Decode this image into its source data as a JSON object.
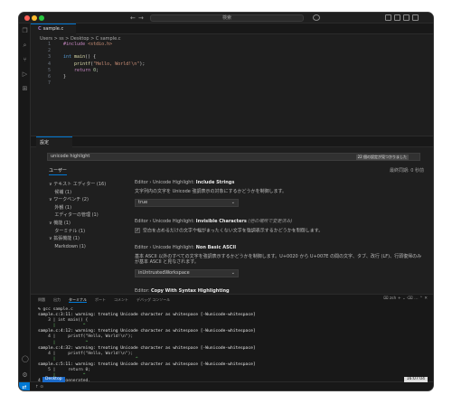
{
  "titlebar": {
    "search_placeholder": "検索",
    "back": "←",
    "forward": "→"
  },
  "activity_bar": {
    "items": [
      "explorer-icon",
      "search-icon",
      "source-control-icon",
      "run-debug-icon",
      "extensions-icon"
    ],
    "account": "account-icon",
    "manage": "gear-icon"
  },
  "editor": {
    "tab": {
      "prefix": "C",
      "label": "sample.c"
    },
    "breadcrumb": "Users > ss > Desktop > C sample.c",
    "line_numbers": [
      "1",
      "2",
      "3",
      "4",
      "5",
      "6",
      "7"
    ],
    "lines": [
      [
        {
          "t": "#include ",
          "c": "pp"
        },
        {
          "t": "<stdio.h>",
          "c": "inc"
        }
      ],
      [],
      [
        {
          "t": "int ",
          "c": "kw"
        },
        {
          "t": "main",
          "c": "fn"
        },
        {
          "t": "() {",
          "c": ""
        }
      ],
      [
        {
          "t": "    ",
          "c": ""
        },
        {
          "t": "printf",
          "c": "fn"
        },
        {
          "t": "(",
          "c": ""
        },
        {
          "t": "\"Hello, World!\\n\"",
          "c": "str"
        },
        {
          "t": ");",
          "c": ""
        }
      ],
      [
        {
          "t": "    ",
          "c": ""
        },
        {
          "t": "return ",
          "c": "pp"
        },
        {
          "t": "0",
          "c": "num"
        },
        {
          "t": ";",
          "c": ""
        }
      ],
      [
        {
          "t": "}",
          "c": ""
        }
      ],
      []
    ]
  },
  "settings": {
    "tab_label": "設定",
    "search_value": "unicode highlight",
    "found_badge": "22 個の設定が見つかりました",
    "user_tab": "ユーザー",
    "last_modified": "最終同期: 0 秒前",
    "tree": [
      "∨ テキスト エディター (16)",
      "    候補 (1)",
      "∨ ワークベンチ (2)",
      "    外観 (1)",
      "    エディターの管理 (1)",
      "∨ 機能 (1)",
      "    ターミナル (1)",
      "∨ 拡張機能 (1)",
      "    Markdown (1)"
    ],
    "items": {
      "include_strings": {
        "crumb": "Editor › Unicode Highlight: ",
        "name": "Include Strings",
        "desc": "文字列内の文字を Unicode 強調表示の対象にするかどうかを制御します。",
        "value": "true"
      },
      "invisible": {
        "crumb": "Editor › Unicode Highlight: ",
        "name": "Invisible Characters",
        "note": " (他の場所で変更済み)",
        "desc": "空白を占めるだけの文字や幅がまったくない文字を強調表示するかどうかを制御します。",
        "checked": "✓"
      },
      "non_basic": {
        "crumb": "Editor › Unicode Highlight: ",
        "name": "Non Basic ASCII",
        "desc": "基本 ASCII 以外のすべての文字を強調表示するかどうかを制御します。U+0020 から U+007E の間の文字、タブ、改行 (LF)、行頭復帰のみが基本 ASCII と見なされます。",
        "value": "inUntrustedWorkspace"
      },
      "copy_syntax": {
        "crumb": "Editor: ",
        "name": "Copy With Syntax Highlighting"
      }
    }
  },
  "panel": {
    "tabs": [
      "問題",
      "出力",
      "ターミナル",
      "ポート",
      "コメント",
      "デバッグ コンソール"
    ],
    "shell_label": "zsh",
    "terminal": [
      "% gcc sample.c",
      "sample.c:3:11: warning: treating Unicode character as whitespace [-Wunicode-whitespace]",
      "    3 | int main() {",
      "      |           ^",
      "sample.c:4:12: warning: treating Unicode character as whitespace [-Wunicode-whitespace]",
      "    4 |     printf(\"Hello, World!\\n\");",
      "      |            ^",
      "sample.c:4:32: warning: treating Unicode character as whitespace [-Wunicode-whitespace]",
      "    4 |     printf(\"Hello, World!\\n\");",
      "      |                                ^",
      "sample.c:5:11: warning: treating Unicode character as whitespace [-Wunicode-whitespace]",
      "    5 |     return 0;",
      "      |           ^",
      "4 warnings generated."
    ]
  },
  "status": {
    "desktop_badge": "Desktop",
    "clock": "16:07:04",
    "branch": "↑ ⊙"
  }
}
